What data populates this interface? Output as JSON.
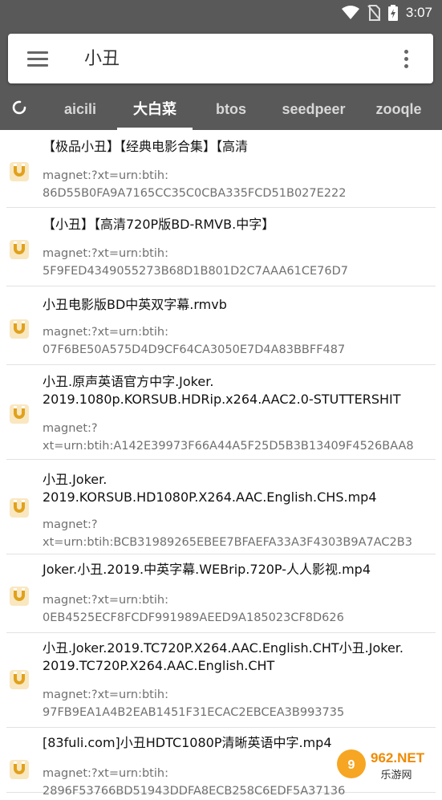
{
  "status_bar": {
    "time": "3:07"
  },
  "search": {
    "query": "小丑"
  },
  "tabs": [
    {
      "label": "aicili",
      "active": false
    },
    {
      "label": "大白菜",
      "active": true
    },
    {
      "label": "btos",
      "active": false
    },
    {
      "label": "seedpeer",
      "active": false
    },
    {
      "label": "zooqle",
      "active": false
    }
  ],
  "results": [
    {
      "title": "【极品小丑】【经典电影合集】【高清",
      "link": "magnet:?xt=urn:btih:\n86D55B0FA9A7165CC35C0CBA335FCD51B027E222"
    },
    {
      "title": "【小丑】【高清720P版BD-RMVB.中字】",
      "link": "magnet:?xt=urn:btih:\n5F9FED4349055273B68D1B801D2C7AAA61CE76D7"
    },
    {
      "title": "小丑电影版BD中英双字幕.rmvb",
      "link": "magnet:?xt=urn:btih:\n07F6BE50A575D4D9CF64CA3050E7D4A83BBFF487"
    },
    {
      "title": "小丑.原声英语官方中字.Joker.\n2019.1080p.KORSUB.HDRip.x264.AAC2.0-STUTTERSHIT",
      "link": "magnet:?\nxt=urn:btih:A142E39973F66A44A5F25D5B3B13409F4526BAA8"
    },
    {
      "title": "小丑.Joker.\n2019.KORSUB.HD1080P.X264.AAC.English.CHS.mp4",
      "link": "magnet:?\nxt=urn:btih:BCB31989265EBEE7BFAEFA33A3F4303B9A7AC2B3"
    },
    {
      "title": "Joker.小丑.2019.中英字幕.WEBrip.720P-人人影视.mp4",
      "link": "magnet:?xt=urn:btih:\n0EB4525ECF8FCDF991989AEED9A185023CF8D626"
    },
    {
      "title": "小丑.Joker.2019.TC720P.X264.AAC.English.CHT小丑.Joker.\n2019.TC720P.X264.AAC.English.CHT",
      "link": "magnet:?xt=urn:btih:\n97FB9EA1A4B2EAB1451F31ECAC2EBCEA3B993735"
    },
    {
      "title": "[83fuli.com]小丑HDTC1080P清晰英语中字.mp4",
      "link": "magnet:?xt=urn:btih:\n2896F53766BD51943DDFA8ECB258C6EDF5A37136"
    }
  ],
  "watermark": {
    "text": "962.NET",
    "sub": "乐游网"
  },
  "colors": {
    "header": "#595959",
    "accent_icon": "#e0a11c"
  }
}
